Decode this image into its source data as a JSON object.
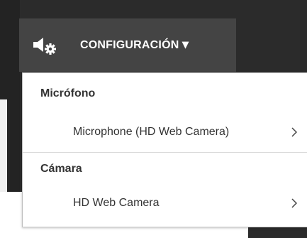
{
  "toolbar": {
    "label": "CONFIGURACIÓN",
    "caret": "▼",
    "icon": "audio-settings-icon"
  },
  "menu": {
    "sections": [
      {
        "header": "Micrófono",
        "item": "Microphone (HD Web Camera)"
      },
      {
        "header": "Cámara",
        "item": "HD Web Camera"
      }
    ]
  },
  "colors": {
    "toolbar_bg": "#444444",
    "page_dark": "#2b2b2b",
    "menu_bg": "#ffffff",
    "text": "#333333"
  }
}
